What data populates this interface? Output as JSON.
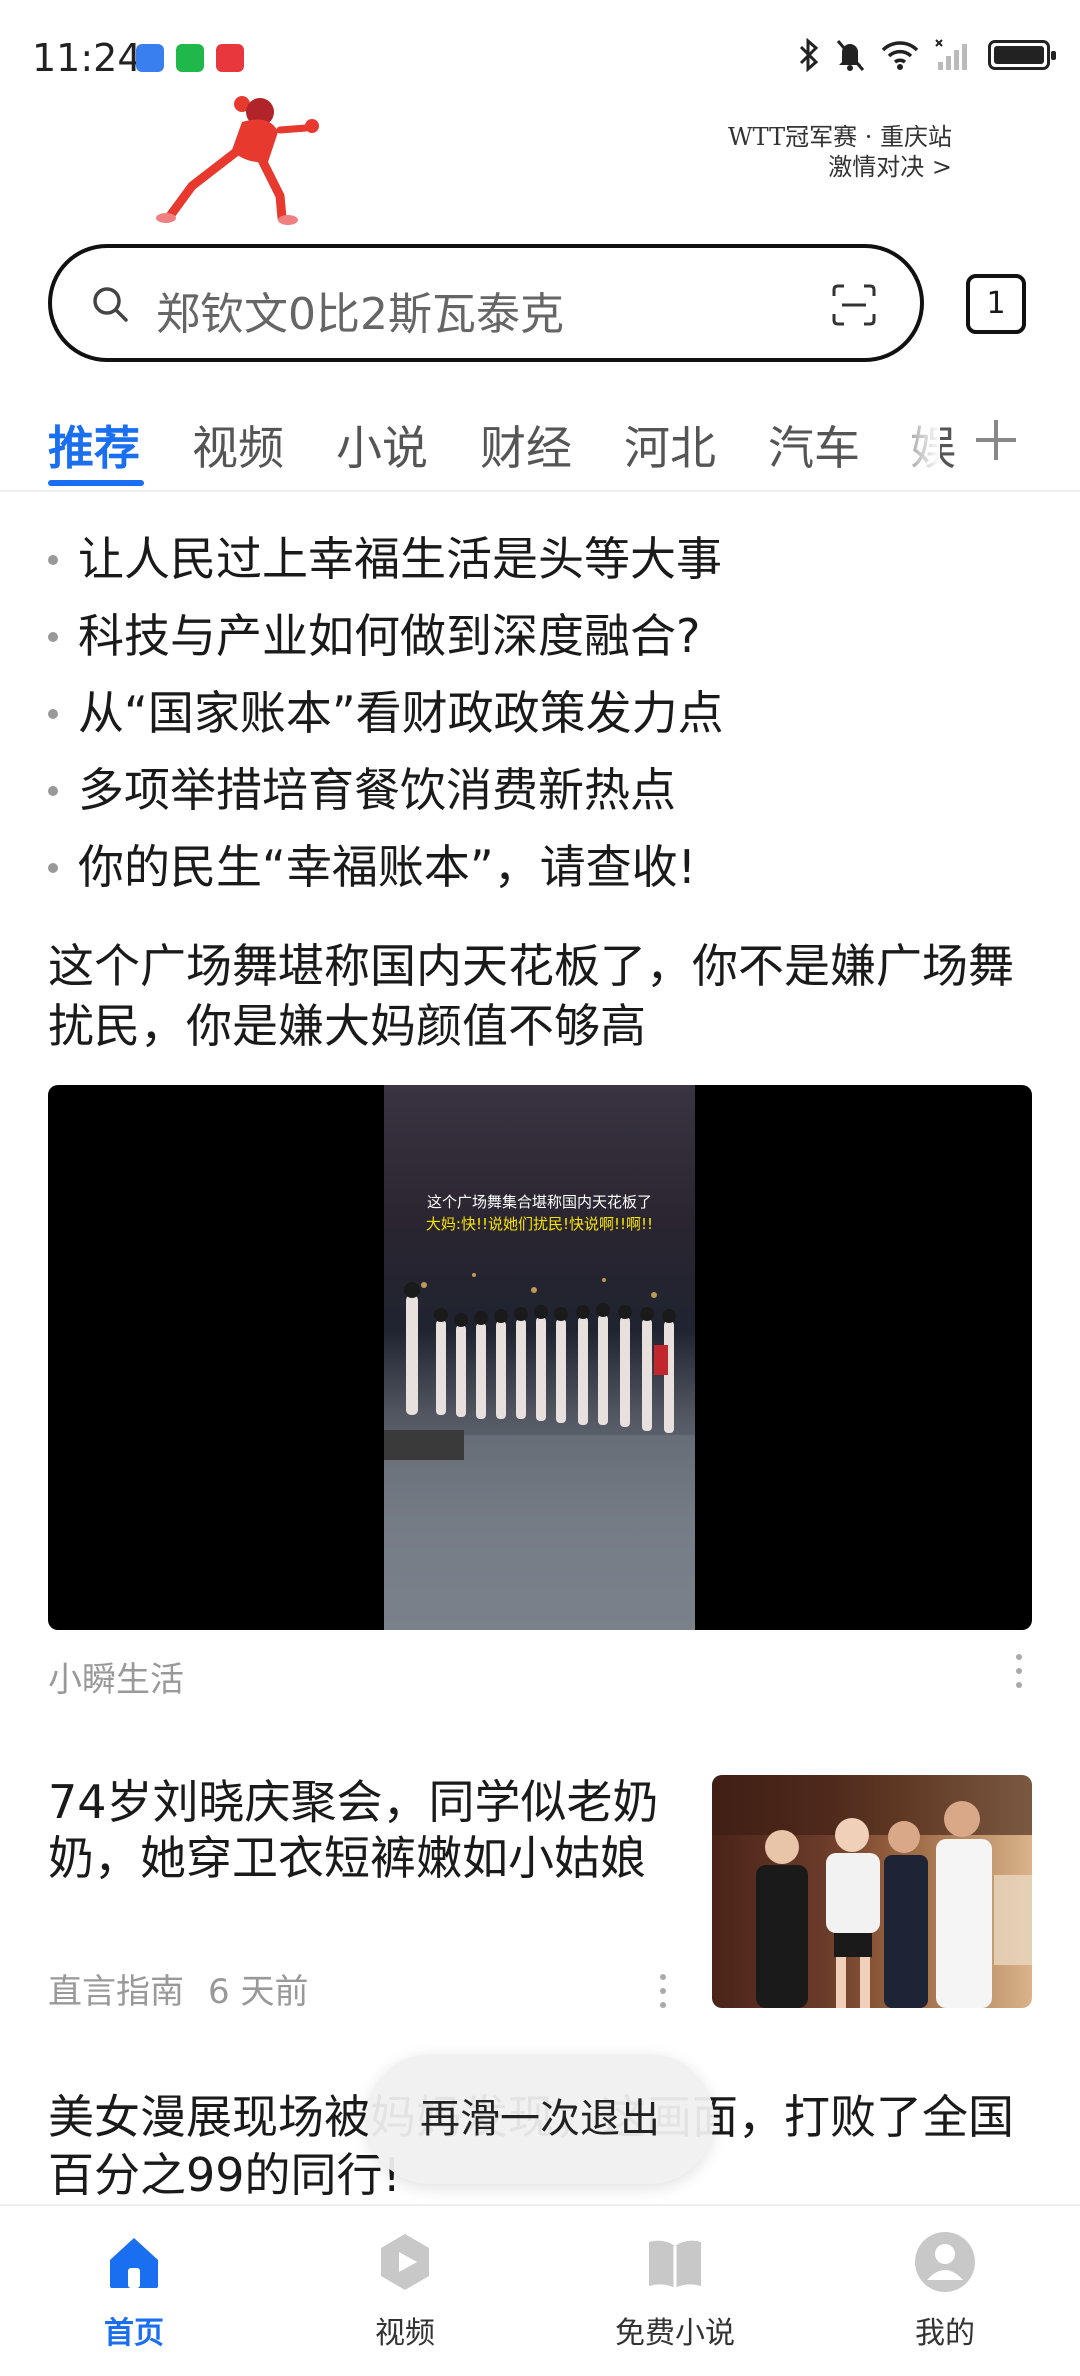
{
  "status_bar": {
    "time": "11:24"
  },
  "banner": {
    "line1": "WTT冠军赛 · 重庆站",
    "line2": "激情对决 >"
  },
  "search": {
    "query": "郑钦文0比2斯瓦泰克",
    "tab_count": "1"
  },
  "channels": [
    "推荐",
    "视频",
    "小说",
    "财经",
    "河北",
    "汽车",
    "娱"
  ],
  "hot_list": [
    "让人民过上幸福生活是头等大事",
    "科技与产业如何做到深度融合?",
    "从“国家账本”看财政政策发力点",
    "多项举措培育餐饮消费新热点",
    "你的民生“幸福账本”，请查收!"
  ],
  "article1": {
    "title": "这个广场舞堪称国内天花板了，你不是嫌广场舞扰民，你是嫌大妈颜值不够高",
    "caption1": "这个广场舞集合堪称国内天花板了",
    "caption2": "大妈:快!!说她们扰民!快说啊!!啊!!",
    "source": "小瞬生活"
  },
  "article2": {
    "title": "74岁刘晓庆聚会，同学似老奶奶，她穿卫衣短裤嫩如小姑娘",
    "source": "直言指南",
    "time": "6 天前"
  },
  "article3": {
    "title": "美女漫展现场被妈妈发现，这画面，打败了全国百分之99的同行!"
  },
  "toast": "再滑一次退出",
  "bottom_nav": [
    {
      "label": "首页"
    },
    {
      "label": "视频"
    },
    {
      "label": "免费小说"
    },
    {
      "label": "我的"
    }
  ],
  "colors": {
    "accent": "#1a6ef0"
  }
}
